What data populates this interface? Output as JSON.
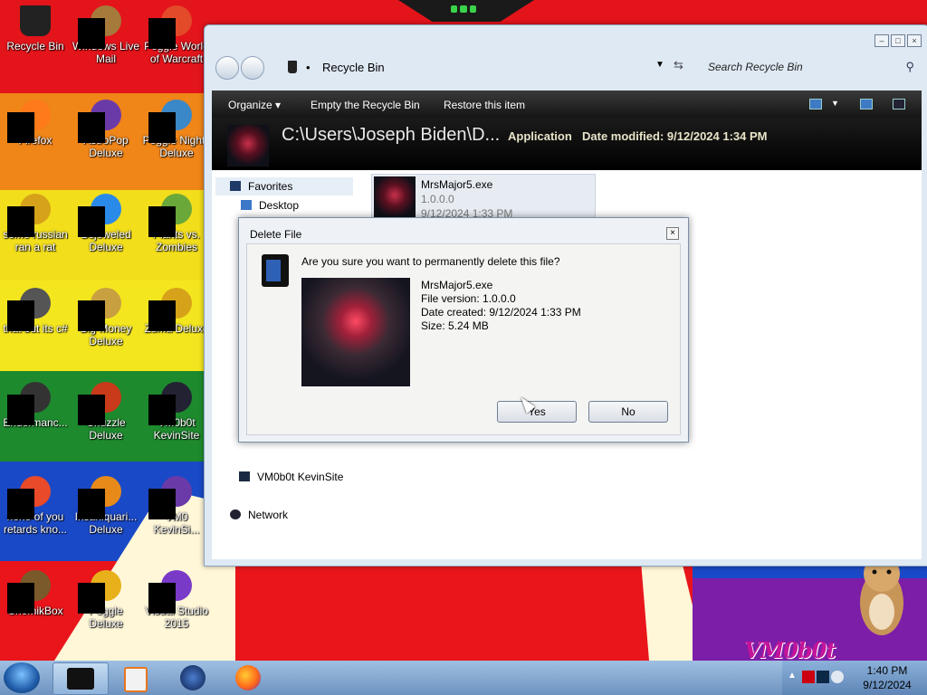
{
  "desktop": {
    "icons": [
      {
        "label": "Recycle Bin",
        "icon": "recycle-bin-icon"
      },
      {
        "label": "Windows Live Mail",
        "icon": "mail-icon"
      },
      {
        "label": "Peggle World of Warcraft",
        "icon": "peggle-icon"
      },
      {
        "label": "Firefox",
        "icon": "firefox-icon"
      },
      {
        "label": "AstroPop Deluxe",
        "icon": "astropop-icon"
      },
      {
        "label": "Peggle Nights Deluxe",
        "icon": "peggle-nights-icon"
      },
      {
        "label": "some russian ran a rat",
        "icon": "app-icon"
      },
      {
        "label": "Bejeweled Deluxe",
        "icon": "bejeweled-icon"
      },
      {
        "label": "Plants vs. Zombies",
        "icon": "plants-vs-zombies-icon"
      },
      {
        "label": "that but its c#",
        "icon": "app-icon"
      },
      {
        "label": "Big Money Deluxe",
        "icon": "money-bag-icon"
      },
      {
        "label": "Zuma Deluxe",
        "icon": "zuma-icon"
      },
      {
        "label": "Endermanc...",
        "icon": "app-icon"
      },
      {
        "label": "Chuzzle Deluxe",
        "icon": "chuzzle-icon"
      },
      {
        "label": "VM0b0t KevinSite",
        "icon": "app-icon"
      },
      {
        "label": "none of you retards kno...",
        "icon": "app-icon"
      },
      {
        "label": "Insaniquari... Deluxe",
        "icon": "insaniquarium-icon"
      },
      {
        "label": "VM0 KevinSi...",
        "icon": "app-icon"
      },
      {
        "label": "ChomikBox",
        "icon": "chomikbox-icon"
      },
      {
        "label": "Peggle Deluxe",
        "icon": "peggle-icon"
      },
      {
        "label": "Visual Studio 2015",
        "icon": "visual-studio-icon"
      }
    ],
    "watermark": "VM0b0t"
  },
  "explorer": {
    "address": "Recycle Bin",
    "search_placeholder": "Search Recycle Bin",
    "toolbar": {
      "organize": "Organize",
      "empty": "Empty the Recycle Bin",
      "restore": "Restore this item"
    },
    "details": {
      "path": "C:\\Users\\Joseph Biden\\D...",
      "type": "Application",
      "modified_label": "Date modified:",
      "modified": "9/12/2024 1:34 PM"
    },
    "nav": {
      "favorites": "Favorites",
      "desktop": "Desktop",
      "kevinsite": "VM0b0t KevinSite",
      "network": "Network"
    },
    "file": {
      "name": "MrsMajor5.exe",
      "version": "1.0.0.0",
      "date": "9/12/2024 1:33 PM"
    }
  },
  "dialog": {
    "title": "Delete File",
    "question": "Are you sure you want to permanently delete this file?",
    "file_name": "MrsMajor5.exe",
    "file_version": "File version: 1.0.0.0",
    "date_created": "Date created: 9/12/2024 1:33 PM",
    "size": "Size: 5.24 MB",
    "yes": "Yes",
    "no": "No"
  },
  "taskbar": {
    "time": "1:40 PM",
    "date": "9/12/2024"
  }
}
